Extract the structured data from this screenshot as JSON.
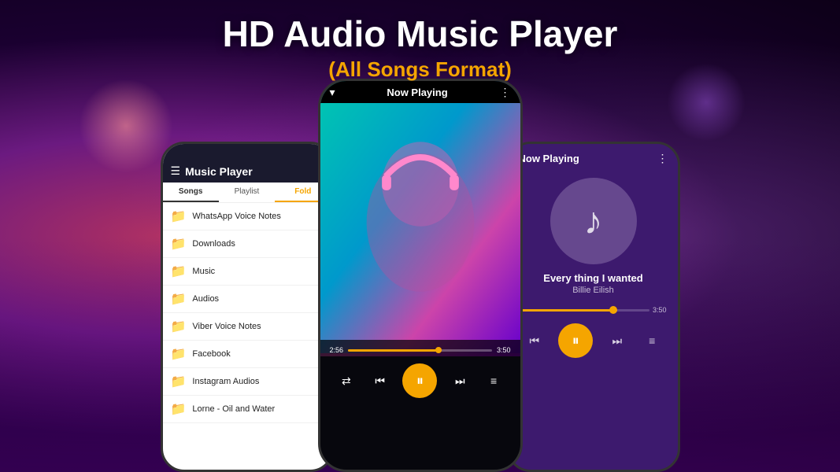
{
  "header": {
    "title": "HD Audio Music Player",
    "subtitle": "(All Songs Format)"
  },
  "left_phone": {
    "app_title": "Music Player",
    "tabs": [
      "Songs",
      "Playlist",
      "Fold"
    ],
    "folders": [
      "WhatsApp Voice Notes",
      "Downloads",
      "Music",
      "Audios",
      "Viber Voice Notes",
      "Facebook",
      "Instagram Audios",
      "Lorne - Oil and Water"
    ]
  },
  "center_phone": {
    "header": "Now Playing",
    "time_elapsed": "2:56",
    "time_total": "3:50",
    "controls": {
      "shuffle": "⇄",
      "prev": "⏮",
      "play_pause": "⏸",
      "next": "⏭",
      "playlist": "≡"
    }
  },
  "right_phone": {
    "header": "Now Playing",
    "song_title": "Every thing I wanted",
    "artist": "Billie Eilish",
    "time_total": "3:50",
    "controls": {
      "prev": "⏮",
      "play_pause": "⏸",
      "next": "⏭",
      "playlist": "≡"
    }
  }
}
